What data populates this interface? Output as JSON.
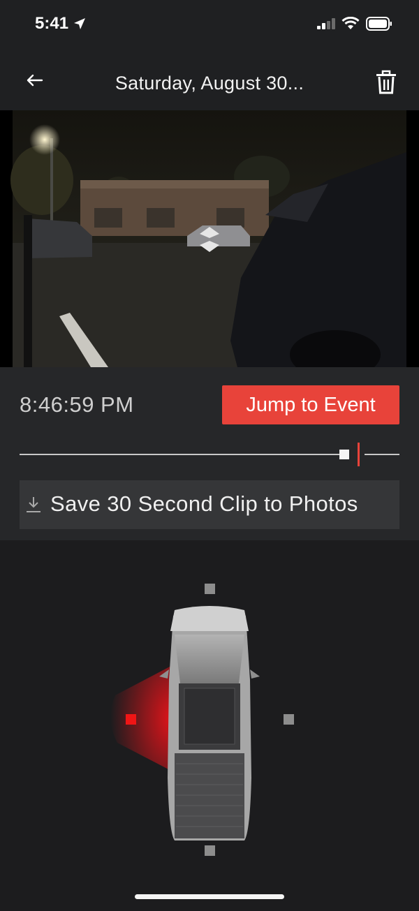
{
  "status_bar": {
    "time": "5:41",
    "location_icon": "location-arrow-icon",
    "signal_icon": "cellular-signal-icon",
    "wifi_icon": "wifi-icon",
    "battery_icon": "battery-icon"
  },
  "header": {
    "back_icon": "arrow-left-icon",
    "title": "Saturday, August 30...",
    "delete_icon": "trash-icon"
  },
  "player": {
    "timestamp": "8:46:59 PM",
    "jump_button": "Jump to Event",
    "save_button": "Save 30 Second Clip to Photos",
    "save_icon": "download-icon",
    "scrubber_position_fraction": 0.85,
    "event_marker_fraction": 0.89
  },
  "camera_map": {
    "vehicle": "pickup-truck-top-view",
    "cameras": [
      {
        "position": "front",
        "active": false
      },
      {
        "position": "left",
        "active": true
      },
      {
        "position": "right",
        "active": false
      },
      {
        "position": "rear",
        "active": false
      }
    ]
  },
  "colors": {
    "accent": "#e8433a",
    "active_camera": "#f01515",
    "inactive_camera": "#8d8d8d",
    "background": "#1c1c1e",
    "panel": "#262729"
  }
}
